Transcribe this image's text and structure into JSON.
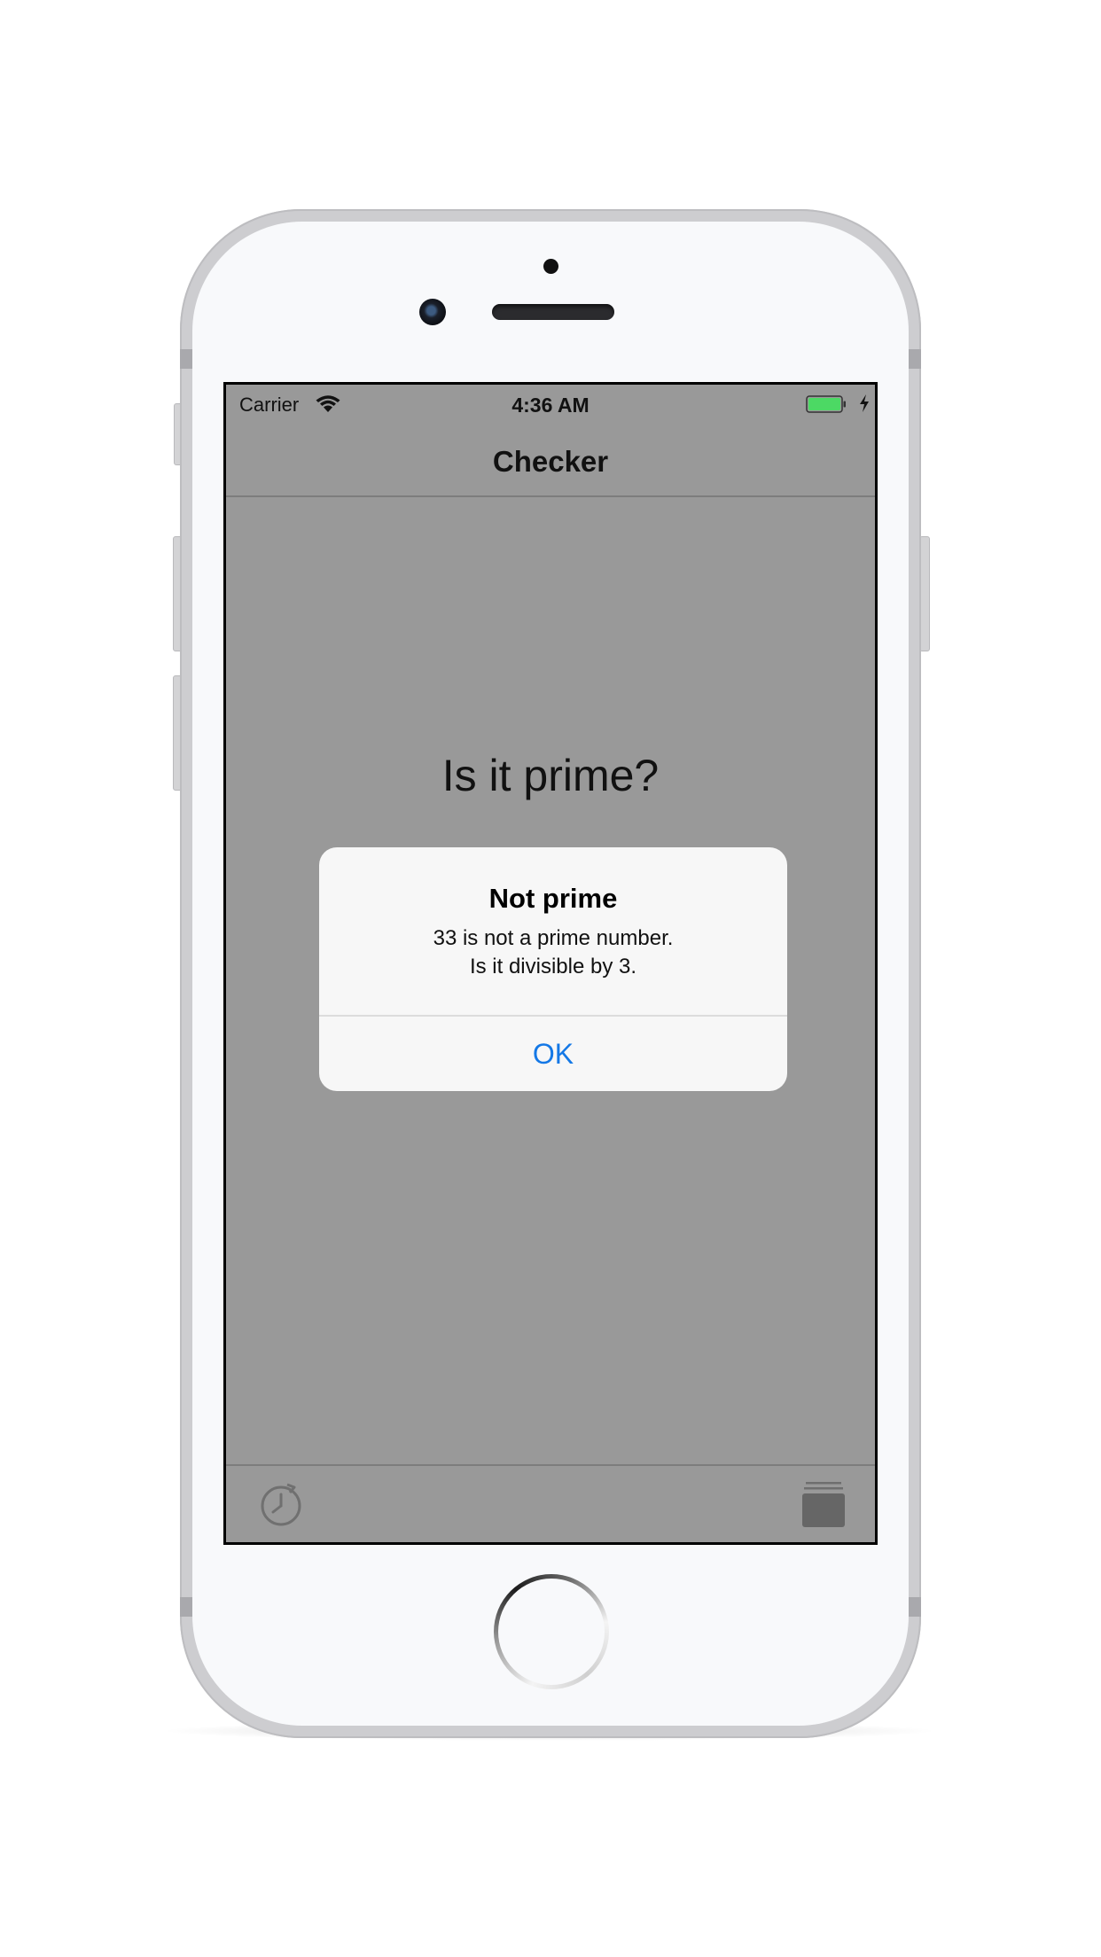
{
  "status_bar": {
    "carrier": "Carrier",
    "time": "4:36 AM",
    "battery_color": "#4cd964"
  },
  "nav": {
    "title": "Checker"
  },
  "main": {
    "question": "Is it prime?"
  },
  "alert": {
    "title": "Not prime",
    "message_line1": "33 is not a prime number.",
    "message_line2": "Is it divisible by 3.",
    "ok_label": "OK",
    "button_color": "#1478e6"
  },
  "tab_bar": {
    "left_icon": "history-icon",
    "right_icon": "stack-icon"
  },
  "colors": {
    "screen_dim_background": "#999999",
    "alert_background": "#f7f7f7"
  }
}
